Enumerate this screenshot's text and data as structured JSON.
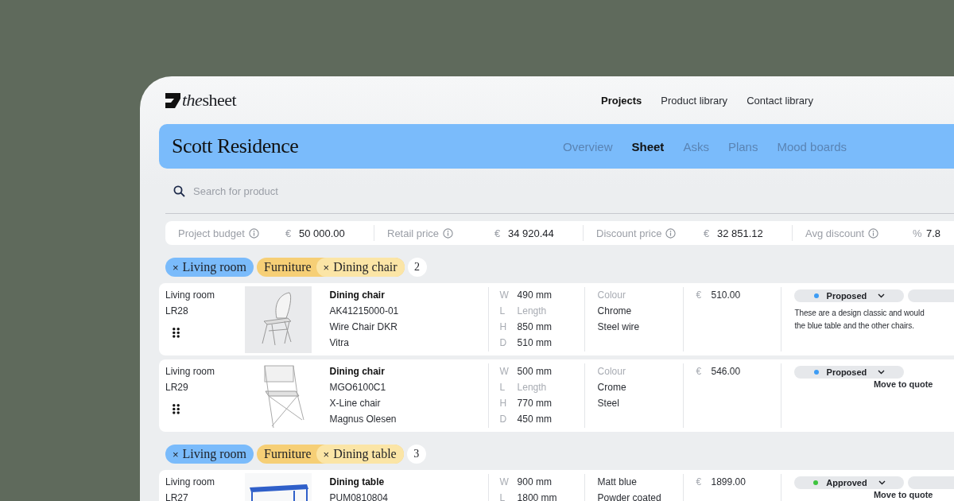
{
  "logo": {
    "prefix": "the",
    "name": "sheet"
  },
  "nav": [
    {
      "label": "Projects",
      "selected": true
    },
    {
      "label": "Product library",
      "selected": false
    },
    {
      "label": "Contact library",
      "selected": false
    }
  ],
  "project": {
    "title": "Scott Residence",
    "tabs": [
      {
        "label": "Overview",
        "selected": false
      },
      {
        "label": "Sheet",
        "selected": true
      },
      {
        "label": "Asks",
        "selected": false
      },
      {
        "label": "Plans",
        "selected": false
      },
      {
        "label": "Mood boards",
        "selected": false
      }
    ]
  },
  "search": {
    "placeholder": "Search for product"
  },
  "summary": [
    {
      "label": "Project budget",
      "unit": "€",
      "value": "50 000.00"
    },
    {
      "label": "Retail price",
      "unit": "€",
      "value": "34 920.44"
    },
    {
      "label": "Discount price",
      "unit": "€",
      "value": "32 851.12"
    },
    {
      "label": "Avg discount",
      "unit": "%",
      "value": "7.8"
    }
  ],
  "groups": [
    {
      "remove": "×",
      "room": "Living room",
      "category": "Furniture",
      "type": "Dining chair",
      "count": "2",
      "items": [
        {
          "location": "Living room",
          "code": "LR28",
          "handle": true,
          "image": {
            "kind": "wire-chair"
          },
          "product": {
            "name": "Dining chair",
            "sku": "AK41215000-01",
            "model": "Wire Chair DKR",
            "brand": "Vitra"
          },
          "dims": [
            {
              "axis": "W",
              "value": "490 mm",
              "empty": false
            },
            {
              "axis": "L",
              "value": "Length",
              "empty": true
            },
            {
              "axis": "H",
              "value": "850 mm",
              "empty": false
            },
            {
              "axis": "D",
              "value": "510 mm",
              "empty": false
            }
          ],
          "finish": [
            {
              "text": "Colour",
              "empty": true
            },
            {
              "text": "Chrome",
              "empty": false
            },
            {
              "text": "Steel wire",
              "empty": false
            }
          ],
          "price": {
            "currency": "€",
            "value": "510.00"
          },
          "status": {
            "label": "Proposed",
            "color": "#3d9cf4"
          },
          "second_pill": true,
          "note": "These are a design classic and would\nthe blue table and the other chairs."
        },
        {
          "location": "Living room",
          "code": "LR29",
          "handle": true,
          "image": {
            "kind": "x-chair"
          },
          "product": {
            "name": "Dining chair",
            "sku": "MGO6100C1",
            "model": "X-Line chair",
            "brand": "Magnus Olesen"
          },
          "dims": [
            {
              "axis": "W",
              "value": "500 mm",
              "empty": false
            },
            {
              "axis": "L",
              "value": "Length",
              "empty": true
            },
            {
              "axis": "H",
              "value": "770 mm",
              "empty": false
            },
            {
              "axis": "D",
              "value": "450 mm",
              "empty": false
            }
          ],
          "finish": [
            {
              "text": "Colour",
              "empty": true
            },
            {
              "text": "Crome",
              "empty": false
            },
            {
              "text": "Steel",
              "empty": false
            }
          ],
          "price": {
            "currency": "€",
            "value": "546.00"
          },
          "status": {
            "label": "Proposed",
            "color": "#3d9cf4"
          },
          "second_pill": false,
          "action": "Move to quote"
        }
      ]
    },
    {
      "remove": "×",
      "room": "Living room",
      "category": "Furniture",
      "type": "Dining table",
      "count": "3",
      "items": [
        {
          "location": "Living room",
          "code": "LR27",
          "handle": false,
          "image": {
            "kind": "table"
          },
          "product": {
            "name": "Dining table",
            "sku": "PUM0810804"
          },
          "dims": [
            {
              "axis": "W",
              "value": "900 mm",
              "empty": false
            },
            {
              "axis": "L",
              "value": "1800 mm",
              "empty": false
            }
          ],
          "finish": [
            {
              "text": "Matt blue",
              "empty": false
            },
            {
              "text": "Powder coated",
              "empty": false
            }
          ],
          "price": {
            "currency": "€",
            "value": "1899.00"
          },
          "status": {
            "label": "Approved",
            "color": "#3ec43e"
          },
          "second_pill": true,
          "action": "Move to quote"
        }
      ]
    }
  ]
}
